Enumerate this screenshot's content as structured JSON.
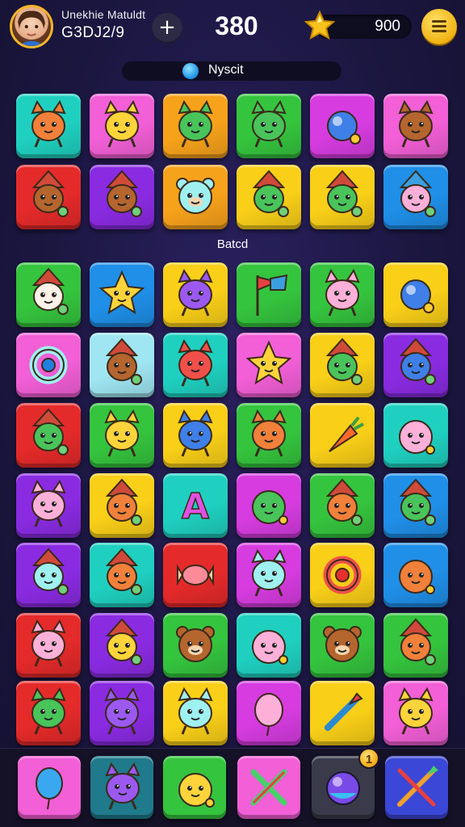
{
  "header": {
    "user_name": "Unekhie Matuldt",
    "user_id": "G3DJ2/9",
    "score": "380",
    "coins": "900",
    "add_icon": "plus-icon",
    "currency_icon": "star-icon",
    "menu_icon": "hamburger-menu-icon"
  },
  "objective": {
    "text": "Nyscit",
    "icon": "blue-orb-icon"
  },
  "section_label": "Batcd",
  "colors": {
    "background": "#1b163f",
    "gold": "#f3b52b",
    "cyan": "#1fd0c0",
    "pink": "#f25fd6",
    "orange": "#f7a21b",
    "green": "#35c43e",
    "magenta": "#d63ce0",
    "red": "#e52a2a",
    "purple": "#8a2be2",
    "blue": "#1f8fe8",
    "yellow": "#f9cf18",
    "light_blue": "#9fe6f2"
  },
  "grid_top": [
    [
      {
        "color": "#1fd0c0",
        "creature": "orange-cat"
      },
      {
        "color": "#f25fd6",
        "creature": "yellow-cat"
      },
      {
        "color": "#f7a21b",
        "creature": "green-cat"
      },
      {
        "color": "#35c43e",
        "creature": "green-cat"
      },
      {
        "color": "#d63ce0",
        "creature": "blue-gem"
      },
      {
        "color": "#f25fd6",
        "creature": "brown-cat"
      }
    ],
    [
      {
        "color": "#e52a2a",
        "creature": "brown-elf"
      },
      {
        "color": "#8a2be2",
        "creature": "brown-elf"
      },
      {
        "color": "#f7a21b",
        "creature": "cyan-bear"
      },
      {
        "color": "#f9cf18",
        "creature": "green-elf"
      },
      {
        "color": "#f9cf18",
        "creature": "green-elf"
      },
      {
        "color": "#1f8fe8",
        "creature": "pink-elf"
      }
    ]
  ],
  "grid_bottom": [
    [
      {
        "color": "#35c43e",
        "creature": "white-elf"
      },
      {
        "color": "#1f8fe8",
        "creature": "yellow-star"
      },
      {
        "color": "#f9cf18",
        "creature": "purple-cat"
      },
      {
        "color": "#35c43e",
        "creature": "flag"
      },
      {
        "color": "#35c43e",
        "creature": "pink-cat"
      },
      {
        "color": "#f9cf18",
        "creature": "blue-orb"
      }
    ],
    [
      {
        "color": "#f25fd6",
        "creature": "cyan-ring"
      },
      {
        "color": "#9fe6f2",
        "creature": "brown-elf"
      },
      {
        "color": "#1fd0c0",
        "creature": "red-cat"
      },
      {
        "color": "#f25fd6",
        "creature": "yellow-star"
      },
      {
        "color": "#f9cf18",
        "creature": "green-elf"
      },
      {
        "color": "#8a2be2",
        "creature": "blue-elf"
      }
    ],
    [
      {
        "color": "#e52a2a",
        "creature": "green-elf"
      },
      {
        "color": "#35c43e",
        "creature": "yellow-cat"
      },
      {
        "color": "#f9cf18",
        "creature": "blue-cat"
      },
      {
        "color": "#35c43e",
        "creature": "orange-cat"
      },
      {
        "color": "#f9cf18",
        "creature": "carrot"
      },
      {
        "color": "#1fd0c0",
        "creature": "pink-blob"
      }
    ],
    [
      {
        "color": "#8a2be2",
        "creature": "pink-cat"
      },
      {
        "color": "#f9cf18",
        "creature": "orange-elf"
      },
      {
        "color": "#1fd0c0",
        "creature": "letter-a"
      },
      {
        "color": "#d63ce0",
        "creature": "green-blob"
      },
      {
        "color": "#35c43e",
        "creature": "orange-elf"
      },
      {
        "color": "#1f8fe8",
        "creature": "green-elf"
      }
    ],
    [
      {
        "color": "#8a2be2",
        "creature": "cyan-elf"
      },
      {
        "color": "#1fd0c0",
        "creature": "orange-elf"
      },
      {
        "color": "#e52a2a",
        "creature": "candy"
      },
      {
        "color": "#d63ce0",
        "creature": "cyan-cat"
      },
      {
        "color": "#f9cf18",
        "creature": "red-ring"
      },
      {
        "color": "#1f8fe8",
        "creature": "orange-blob"
      }
    ],
    [
      {
        "color": "#e52a2a",
        "creature": "pink-cat"
      },
      {
        "color": "#8a2be2",
        "creature": "yellow-elf"
      },
      {
        "color": "#35c43e",
        "creature": "brown-bear"
      },
      {
        "color": "#1fd0c0",
        "creature": "pink-blob"
      },
      {
        "color": "#35c43e",
        "creature": "brown-bear"
      },
      {
        "color": "#35c43e",
        "creature": "orange-elf"
      }
    ],
    [
      {
        "color": "#e52a2a",
        "creature": "green-cat"
      },
      {
        "color": "#8a2be2",
        "creature": "purple-cat"
      },
      {
        "color": "#f9cf18",
        "creature": "cyan-cat"
      },
      {
        "color": "#d63ce0",
        "creature": "pink-balloon"
      },
      {
        "color": "#f9cf18",
        "creature": "arrow"
      },
      {
        "color": "#f25fd6",
        "creature": "yellow-cat"
      }
    ]
  ],
  "boosters": [
    {
      "color": "#f25fd6",
      "icon": "balloon-icon",
      "count": ""
    },
    {
      "color": "#1f7a8c",
      "icon": "purple-cat-icon",
      "count": ""
    },
    {
      "color": "#35c43e",
      "icon": "yellow-blob-icon",
      "count": ""
    },
    {
      "color": "#f25fd6",
      "icon": "crossed-swords-icon",
      "count": ""
    },
    {
      "color": "#3a3a4a",
      "icon": "purple-orb-icon",
      "count": "1"
    },
    {
      "color": "#3b47d6",
      "icon": "crossed-arrows-icon",
      "count": ""
    }
  ]
}
